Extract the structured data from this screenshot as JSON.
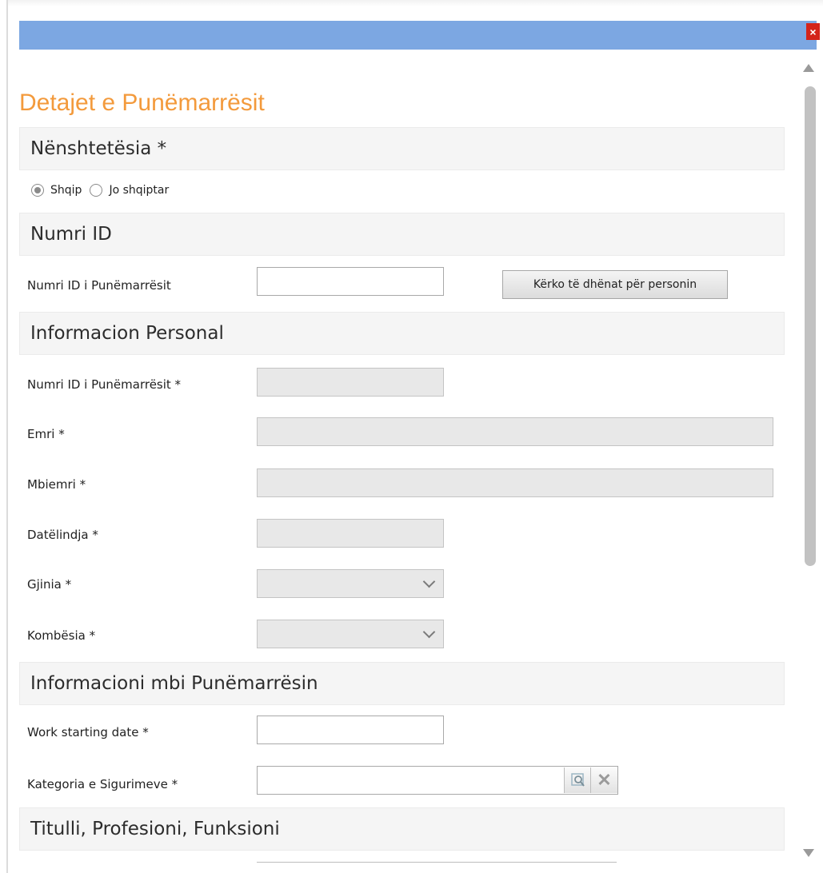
{
  "window": {
    "close_glyph": "×",
    "titlebar_color": "#7ca7e2",
    "close_color": "#d4241a"
  },
  "page_title": "Detajet e Punëmarrësit",
  "title_color": "#f39a3c",
  "nationality": {
    "header": "Nënshtetësia *",
    "options": [
      {
        "label": "Shqip",
        "selected": true
      },
      {
        "label": "Jo shqiptar",
        "selected": false
      }
    ]
  },
  "id_section": {
    "header": "Numri ID",
    "id_label": "Numri ID i Punëmarrësit",
    "id_value": "",
    "search_button": "Kërko të dhënat për personin"
  },
  "personal": {
    "header": "Informacion Personal",
    "fields": {
      "id": {
        "label": "Numri ID i Punëmarrësit *",
        "value": ""
      },
      "first_name": {
        "label": "Emri *",
        "value": ""
      },
      "last_name": {
        "label": "Mbiemri *",
        "value": ""
      },
      "birth_date": {
        "label": "Datëlindja *",
        "value": ""
      },
      "gender": {
        "label": "Gjinia *",
        "value": ""
      },
      "nationality": {
        "label": "Kombësia *",
        "value": ""
      }
    }
  },
  "employee": {
    "header": "Informacioni mbi Punëmarrësin",
    "work_start": {
      "label": "Work starting date *",
      "value": ""
    },
    "insurance_category": {
      "label": "Kategoria e Sigurimeve *",
      "value": "",
      "clear_glyph": "✕"
    }
  },
  "title_section": {
    "header": "Titulli, Profesioni, Funksioni"
  },
  "icons": {
    "close": "close-icon",
    "radio": "radio-button-icon",
    "dropdown": "chevron-down-icon",
    "lookup": "magnifier-icon",
    "clear": "clear-x-icon",
    "scroll_up": "scroll-up-arrow-icon",
    "scroll_down": "scroll-down-arrow-icon"
  }
}
